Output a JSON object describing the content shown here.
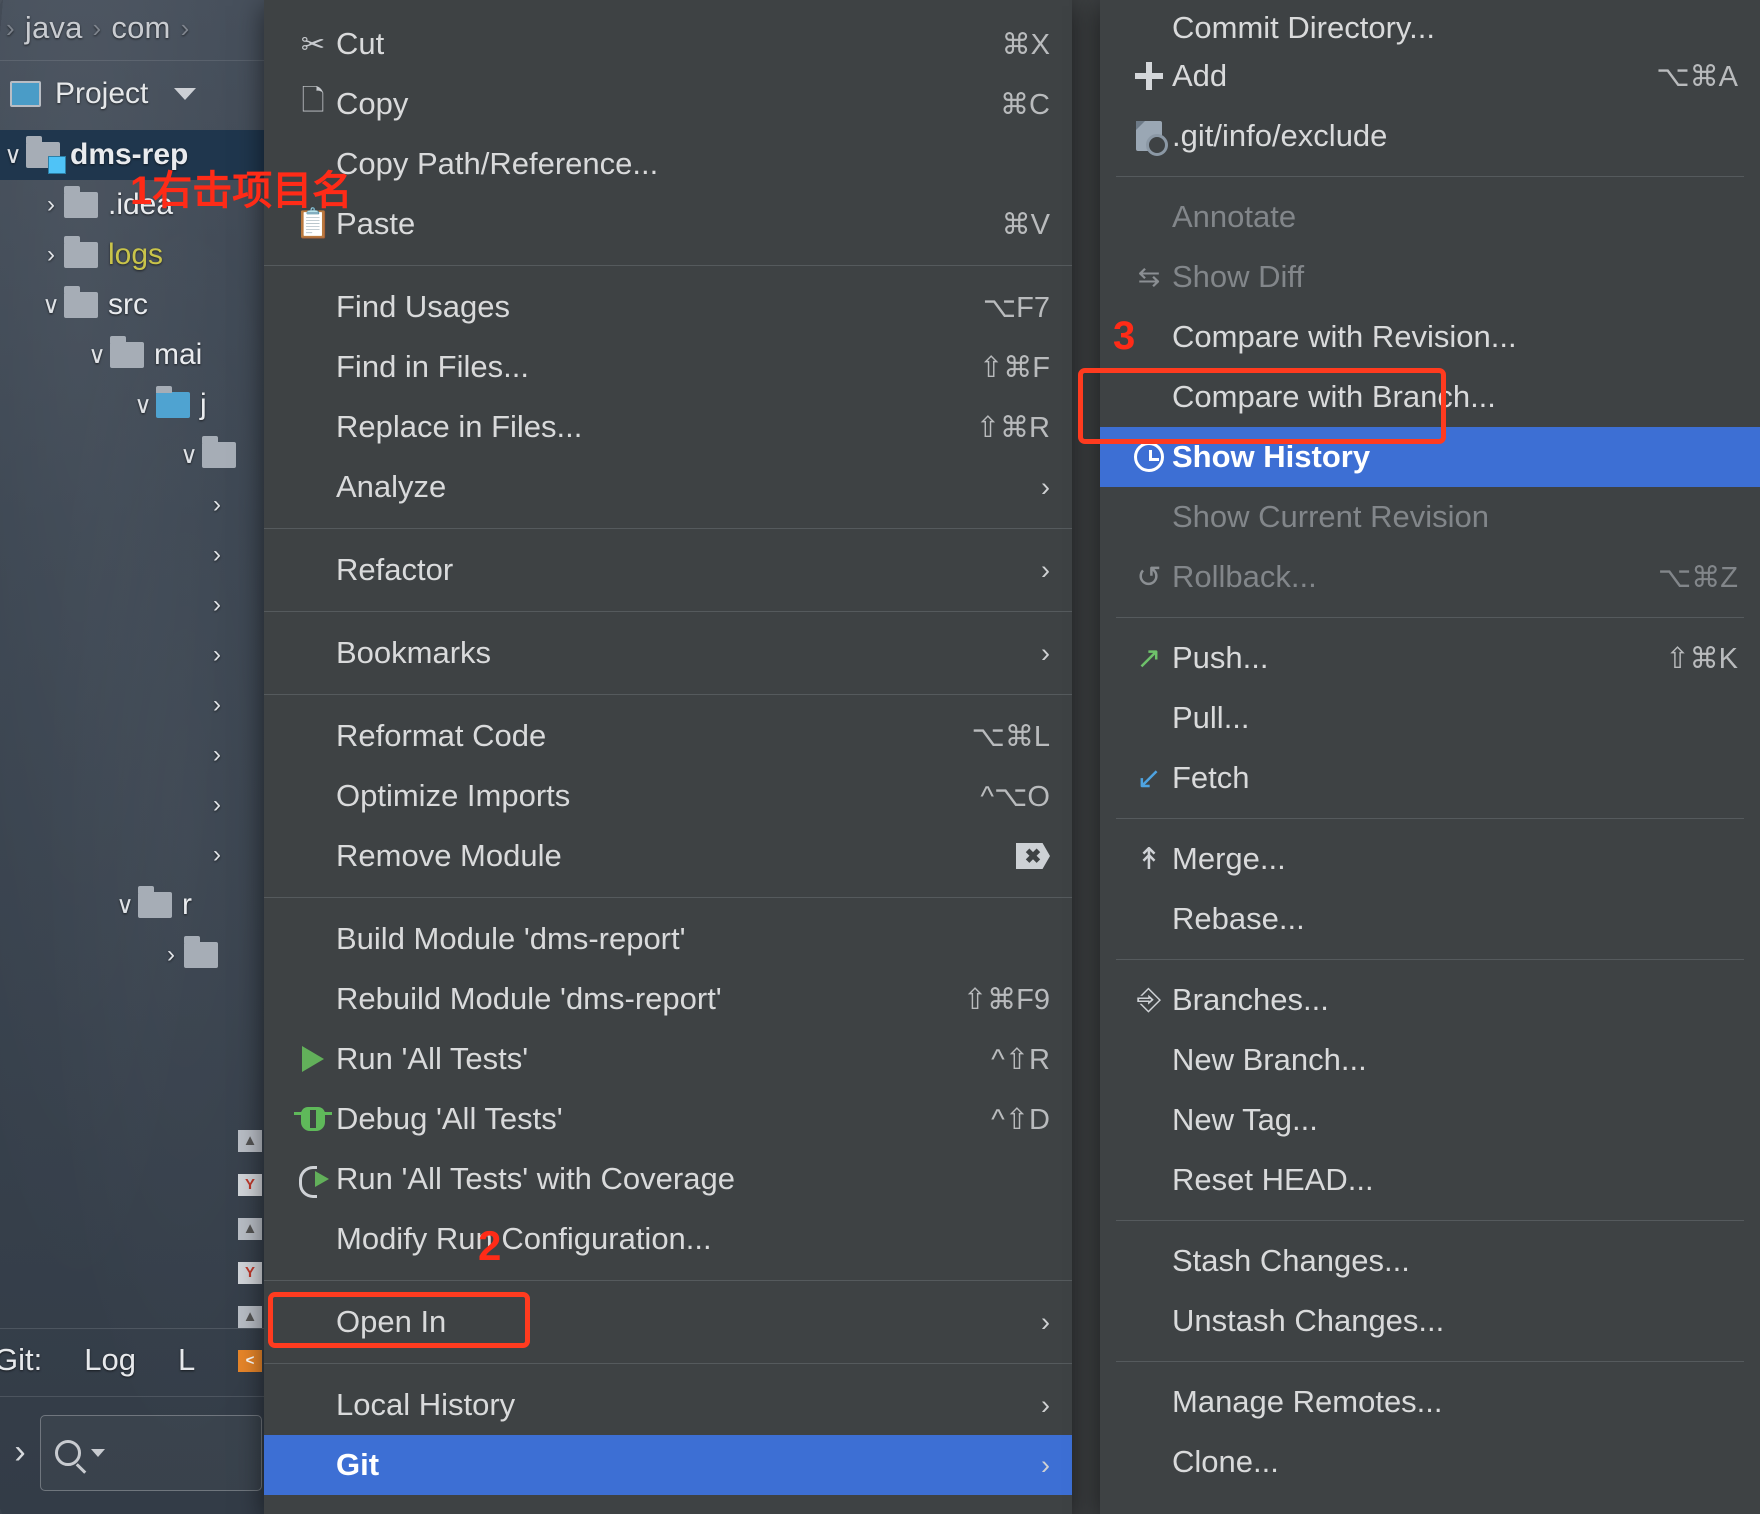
{
  "ide": {
    "breadcrumb": [
      "java",
      "com"
    ],
    "breadcrumb_separator": "›",
    "tool_window": {
      "title": "Project",
      "icon": "project-icon",
      "caret": "chevron-down-icon"
    },
    "tree": [
      {
        "label": "dms-rep",
        "chevron": "∨",
        "indent": 0,
        "selected": true,
        "bold": true,
        "color": "default",
        "badge": true
      },
      {
        "label": ".idea",
        "chevron": "›",
        "indent": 1,
        "selected": false,
        "bold": false,
        "color": "default",
        "badge": false
      },
      {
        "label": "logs",
        "chevron": "›",
        "indent": 1,
        "selected": false,
        "bold": false,
        "color": "yellow",
        "badge": false
      },
      {
        "label": "src",
        "chevron": "∨",
        "indent": 1,
        "selected": false,
        "bold": false,
        "color": "default",
        "badge": false
      },
      {
        "label": "mai",
        "chevron": "∨",
        "indent": 2,
        "selected": false,
        "bold": false,
        "color": "default",
        "badge": false
      },
      {
        "label": "j",
        "chevron": "∨",
        "indent": 3,
        "selected": false,
        "bold": false,
        "color": "default",
        "badge": false,
        "java": true
      },
      {
        "label": "",
        "chevron": "∨",
        "indent": 4,
        "selected": false,
        "bold": false,
        "color": "default",
        "badge": false
      }
    ],
    "collapsed_rows": [
      "›",
      "›",
      "›",
      "›",
      "›",
      "›",
      "›",
      "›"
    ],
    "extra_rows": [
      {
        "label": "r",
        "chevron": "∨",
        "indent": 2
      },
      {
        "label": "",
        "chevron": "›",
        "indent": 3
      }
    ],
    "status_bar": {
      "git_label": "Git:",
      "log_tab": "Log",
      "second_tab": "L"
    },
    "search": {
      "placeholder": "",
      "icon": "search-icon"
    },
    "gutter_marks": [
      "Y",
      "▲",
      "Y",
      "▲",
      "<"
    ]
  },
  "context_menu": {
    "groups": [
      {
        "items": [
          {
            "label": "Cut",
            "icon": "cut-icon",
            "shortcut": "⌘X",
            "arrow": false,
            "disabled": false
          },
          {
            "label": "Copy",
            "icon": "copy-icon",
            "shortcut": "⌘C",
            "arrow": false,
            "disabled": false
          },
          {
            "label": "Copy Path/Reference...",
            "icon": "",
            "shortcut": "",
            "arrow": false,
            "disabled": false
          },
          {
            "label": "Paste",
            "icon": "paste-icon",
            "shortcut": "⌘V",
            "arrow": false,
            "disabled": false
          }
        ]
      },
      {
        "items": [
          {
            "label": "Find Usages",
            "icon": "",
            "shortcut": "⌥F7",
            "arrow": false,
            "disabled": false
          },
          {
            "label": "Find in Files...",
            "icon": "",
            "shortcut": "⇧⌘F",
            "arrow": false,
            "disabled": false
          },
          {
            "label": "Replace in Files...",
            "icon": "",
            "shortcut": "⇧⌘R",
            "arrow": false,
            "disabled": false
          },
          {
            "label": "Analyze",
            "icon": "",
            "shortcut": "",
            "arrow": true,
            "disabled": false
          }
        ]
      },
      {
        "items": [
          {
            "label": "Refactor",
            "icon": "",
            "shortcut": "",
            "arrow": true,
            "disabled": false
          }
        ]
      },
      {
        "items": [
          {
            "label": "Bookmarks",
            "icon": "",
            "shortcut": "",
            "arrow": true,
            "disabled": false
          }
        ]
      },
      {
        "items": [
          {
            "label": "Reformat Code",
            "icon": "",
            "shortcut": "⌥⌘L",
            "arrow": false,
            "disabled": false
          },
          {
            "label": "Optimize Imports",
            "icon": "",
            "shortcut": "^⌥O",
            "arrow": false,
            "disabled": false
          },
          {
            "label": "Remove Module",
            "icon": "",
            "shortcut": "x-badge",
            "arrow": false,
            "disabled": false
          }
        ]
      },
      {
        "items": [
          {
            "label": "Build Module 'dms-report'",
            "icon": "",
            "shortcut": "",
            "arrow": false,
            "disabled": false
          },
          {
            "label": "Rebuild Module 'dms-report'",
            "icon": "",
            "shortcut": "⇧⌘F9",
            "arrow": false,
            "disabled": false
          },
          {
            "label": "Run 'All Tests'",
            "icon": "run-icon",
            "shortcut": "^⇧R",
            "arrow": false,
            "disabled": false
          },
          {
            "label": "Debug 'All Tests'",
            "icon": "debug-icon",
            "shortcut": "^⇧D",
            "arrow": false,
            "disabled": false
          },
          {
            "label": "Run 'All Tests' with Coverage",
            "icon": "coverage-icon",
            "shortcut": "",
            "arrow": false,
            "disabled": false
          },
          {
            "label": "Modify Run Configuration...",
            "icon": "",
            "shortcut": "",
            "arrow": false,
            "disabled": false
          }
        ]
      },
      {
        "items": [
          {
            "label": "Open In",
            "icon": "",
            "shortcut": "",
            "arrow": true,
            "disabled": false
          }
        ]
      },
      {
        "items": [
          {
            "label": "Local History",
            "icon": "",
            "shortcut": "",
            "arrow": true,
            "disabled": false,
            "highlighted": false
          },
          {
            "label": "Git",
            "icon": "",
            "shortcut": "",
            "arrow": true,
            "disabled": false,
            "highlighted": true
          }
        ]
      }
    ]
  },
  "git_submenu": {
    "groups": [
      {
        "items": [
          {
            "label": "Commit Directory...",
            "icon": "",
            "shortcut": "",
            "arrow": false,
            "disabled": false,
            "clipped": true
          },
          {
            "label": "Add",
            "icon": "plus-icon",
            "shortcut": "⌥⌘A",
            "arrow": false,
            "disabled": false
          },
          {
            "label": ".git/info/exclude",
            "icon": "file-exclude-icon",
            "shortcut": "",
            "arrow": false,
            "disabled": false
          }
        ]
      },
      {
        "items": [
          {
            "label": "Annotate",
            "icon": "",
            "shortcut": "",
            "arrow": false,
            "disabled": true
          },
          {
            "label": "Show Diff",
            "icon": "show-diff-icon",
            "shortcut": "",
            "arrow": false,
            "disabled": true
          },
          {
            "label": "Compare with Revision...",
            "icon": "",
            "shortcut": "",
            "arrow": false,
            "disabled": false
          },
          {
            "label": "Compare with Branch...",
            "icon": "",
            "shortcut": "",
            "arrow": false,
            "disabled": false
          },
          {
            "label": "Show History",
            "icon": "clock-icon",
            "shortcut": "",
            "arrow": false,
            "disabled": false,
            "highlighted": true
          },
          {
            "label": "Show Current Revision",
            "icon": "",
            "shortcut": "",
            "arrow": false,
            "disabled": true
          },
          {
            "label": "Rollback...",
            "icon": "rollback-icon",
            "shortcut": "⌥⌘Z",
            "arrow": false,
            "disabled": true
          }
        ]
      },
      {
        "items": [
          {
            "label": "Push...",
            "icon": "push-icon",
            "shortcut": "⇧⌘K",
            "arrow": false,
            "disabled": false
          },
          {
            "label": "Pull...",
            "icon": "",
            "shortcut": "",
            "arrow": false,
            "disabled": false
          },
          {
            "label": "Fetch",
            "icon": "fetch-icon",
            "shortcut": "",
            "arrow": false,
            "disabled": false
          }
        ]
      },
      {
        "items": [
          {
            "label": "Merge...",
            "icon": "merge-icon",
            "shortcut": "",
            "arrow": false,
            "disabled": false
          },
          {
            "label": "Rebase...",
            "icon": "",
            "shortcut": "",
            "arrow": false,
            "disabled": false
          }
        ]
      },
      {
        "items": [
          {
            "label": "Branches...",
            "icon": "branch-icon",
            "shortcut": "",
            "arrow": false,
            "disabled": false
          },
          {
            "label": "New Branch...",
            "icon": "",
            "shortcut": "",
            "arrow": false,
            "disabled": false
          },
          {
            "label": "New Tag...",
            "icon": "",
            "shortcut": "",
            "arrow": false,
            "disabled": false
          },
          {
            "label": "Reset HEAD...",
            "icon": "",
            "shortcut": "",
            "arrow": false,
            "disabled": false
          }
        ]
      },
      {
        "items": [
          {
            "label": "Stash Changes...",
            "icon": "",
            "shortcut": "",
            "arrow": false,
            "disabled": false
          },
          {
            "label": "Unstash Changes...",
            "icon": "",
            "shortcut": "",
            "arrow": false,
            "disabled": false
          }
        ]
      },
      {
        "items": [
          {
            "label": "Manage Remotes...",
            "icon": "",
            "shortcut": "",
            "arrow": false,
            "disabled": false
          },
          {
            "label": "Clone...",
            "icon": "",
            "shortcut": "",
            "arrow": false,
            "disabled": false
          }
        ]
      }
    ]
  },
  "annotations": {
    "step1": "1右击项目名",
    "step2": "2",
    "step3": "3",
    "color": "#ff3b1f"
  }
}
